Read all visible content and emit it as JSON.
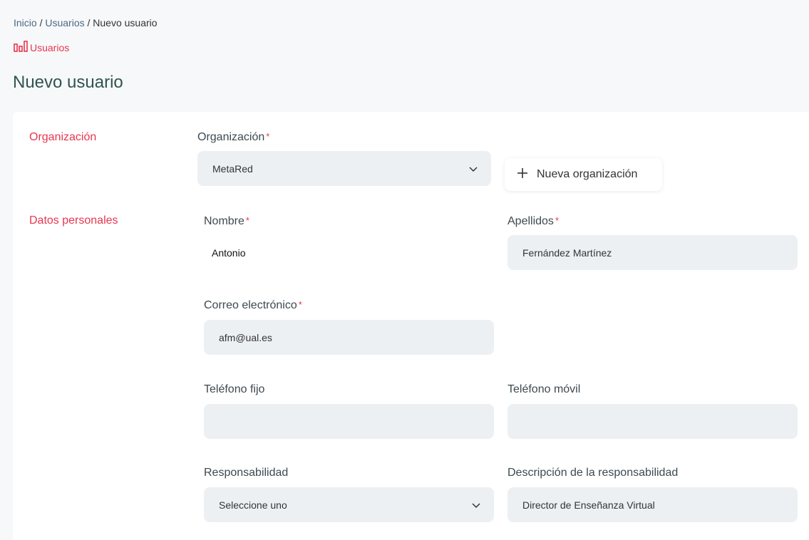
{
  "breadcrumb": {
    "inicio": "Inicio",
    "sep1": " / ",
    "usuarios": "Usuarios",
    "sep2": " / ",
    "current": "Nuevo usuario"
  },
  "section_link": {
    "label": "Usuarios",
    "icon": "chart-bars-icon"
  },
  "page_title": "Nuevo usuario",
  "colors": {
    "accent": "#e8364f",
    "title": "#2f5450",
    "input_bg": "#edf0f3"
  },
  "form": {
    "sections": {
      "organizacion": "Organización",
      "datos_personales": "Datos personales"
    },
    "organizacion": {
      "label": "Organización",
      "required_mark": "*",
      "value": "MetaRed"
    },
    "nueva_organizacion": {
      "label": "Nueva organización",
      "icon": "plus-icon"
    },
    "nombre": {
      "label": "Nombre",
      "required_mark": "*",
      "value": "Antonio"
    },
    "apellidos": {
      "label": "Apellidos",
      "required_mark": "*",
      "value": "Fernández Martínez"
    },
    "correo": {
      "label": "Correo electrónico",
      "required_mark": "*",
      "value": "afm@ual.es"
    },
    "telefono_fijo": {
      "label": "Teléfono fijo",
      "value": ""
    },
    "telefono_movil": {
      "label": "Teléfono móvil",
      "value": ""
    },
    "responsabilidad": {
      "label": "Responsabilidad",
      "value": "Seleccione uno"
    },
    "descripcion_responsabilidad": {
      "label": "Descripción de la responsabilidad",
      "value": "Director de Enseñanza Virtual"
    }
  }
}
